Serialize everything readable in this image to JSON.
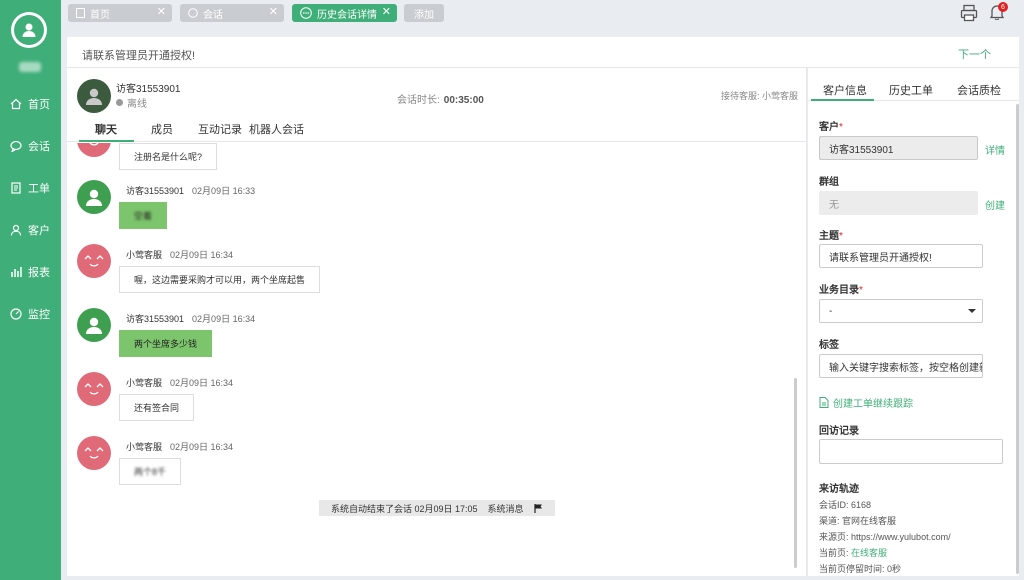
{
  "sidebar": {
    "items": [
      {
        "label": "首页",
        "icon": "home-icon"
      },
      {
        "label": "会话",
        "icon": "chat-icon"
      },
      {
        "label": "工单",
        "icon": "ticket-icon"
      },
      {
        "label": "客户",
        "icon": "user-icon"
      },
      {
        "label": "报表",
        "icon": "chart-icon"
      },
      {
        "label": "监控",
        "icon": "monitor-icon"
      }
    ]
  },
  "tabs": [
    {
      "label": "首页",
      "icon": "document-icon"
    },
    {
      "label": "会话",
      "icon": "chat-icon"
    },
    {
      "label": "历史会话详情",
      "icon": "chat-bubble-icon"
    },
    {
      "label": "添加"
    }
  ],
  "header": {
    "notification_count": "6"
  },
  "notice": {
    "title": "请联系管理员开通授权!",
    "next": "下一个"
  },
  "chat": {
    "visitor_name": "访客31553901",
    "visitor_status": "离线",
    "duration_label": "会话时长:",
    "duration": "00:35:00",
    "agent_label": "接待客服: 小莺客服",
    "tabs": [
      "聊天",
      "成员",
      "互动记录",
      "机器人会话"
    ],
    "messages": [
      {
        "who": "agent",
        "name": "",
        "time": "",
        "text": "注册名是什么呢?",
        "blur": false
      },
      {
        "who": "visitor",
        "name": "访客31553901",
        "time": "02月09日 16:33",
        "text": "空着",
        "blur": true
      },
      {
        "who": "agent",
        "name": "小莺客服",
        "time": "02月09日 16:34",
        "text": "喔，这边需要采购才可以用，两个坐席起售",
        "blur": false
      },
      {
        "who": "visitor",
        "name": "访客31553901",
        "time": "02月09日 16:34",
        "text": "两个坐席多少钱",
        "blur": false
      },
      {
        "who": "agent",
        "name": "小莺客服",
        "time": "02月09日 16:34",
        "text": "还有签合同",
        "blur": false
      },
      {
        "who": "agent",
        "name": "小莺客服",
        "time": "02月09日 16:34",
        "text": "两个8千",
        "blur": true
      }
    ],
    "system_message": {
      "text": "系统自动结束了会话 02月09日 17:05",
      "tag": "系统消息"
    }
  },
  "customer_panel": {
    "tabs": [
      "客户信息",
      "历史工单",
      "会话质检"
    ],
    "customer_label": "客户",
    "customer_value": "访客31553901",
    "customer_link": "详情",
    "group_label": "群组",
    "group_value": "无",
    "group_link": "创建",
    "subject_label": "主题",
    "subject_value": "请联系管理员开通授权!",
    "category_label": "业务目录",
    "category_value": "-",
    "tags_label": "标签",
    "tags_placeholder": "输入关键字搜索标签，按空格创建新标签",
    "create_ticket": "创建工单继续跟踪",
    "revisit_label": "回访记录",
    "trail_label": "来访轨迹",
    "trail": {
      "session_id_label": "会话ID:",
      "session_id": "6168",
      "channel_label": "渠道:",
      "channel": "官网在线客服",
      "source_label": "来源页:",
      "source": "https://www.yulubot.com/",
      "current_label": "当前页:",
      "current": "在线客服",
      "stay_label": "当前页停留时间:",
      "stay": "0秒"
    }
  }
}
